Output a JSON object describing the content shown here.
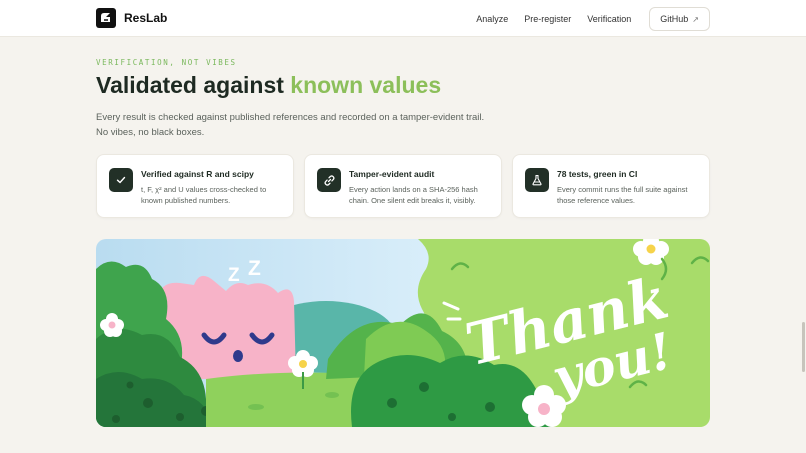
{
  "nav": {
    "brand": "ResLab",
    "links": [
      "Analyze",
      "Pre-register",
      "Verification"
    ],
    "github_label": "GitHub",
    "github_icon": "external-link-icon"
  },
  "hero": {
    "eyebrow": "VERIFICATION, NOT VIBES",
    "headline_main": "Validated against ",
    "headline_accent": "known values",
    "subtitle_line1": "Every result is checked against published references and recorded on a tamper-evident trail.",
    "subtitle_line2": "No vibes, no black boxes."
  },
  "cards": [
    {
      "icon": "check-icon",
      "title": "Verified against R and scipy",
      "desc": "t, F, χ² and U values cross-checked to known published numbers."
    },
    {
      "icon": "link-icon",
      "title": "Tamper-evident audit",
      "desc": "Every action lands on a SHA-256 hash chain. One silent edit breaks it, visibly."
    },
    {
      "icon": "flask-icon",
      "title": "78 tests, green in CI",
      "desc": "Every commit runs the full suite against those reference values."
    }
  ],
  "illustration": {
    "text_line1": "Thank",
    "text_line2": "you!",
    "zz": "Z Z"
  },
  "colors": {
    "accent_green": "#8cbf5a",
    "dark_icon_bg": "#223027",
    "page_bg": "#f5f3ee"
  }
}
